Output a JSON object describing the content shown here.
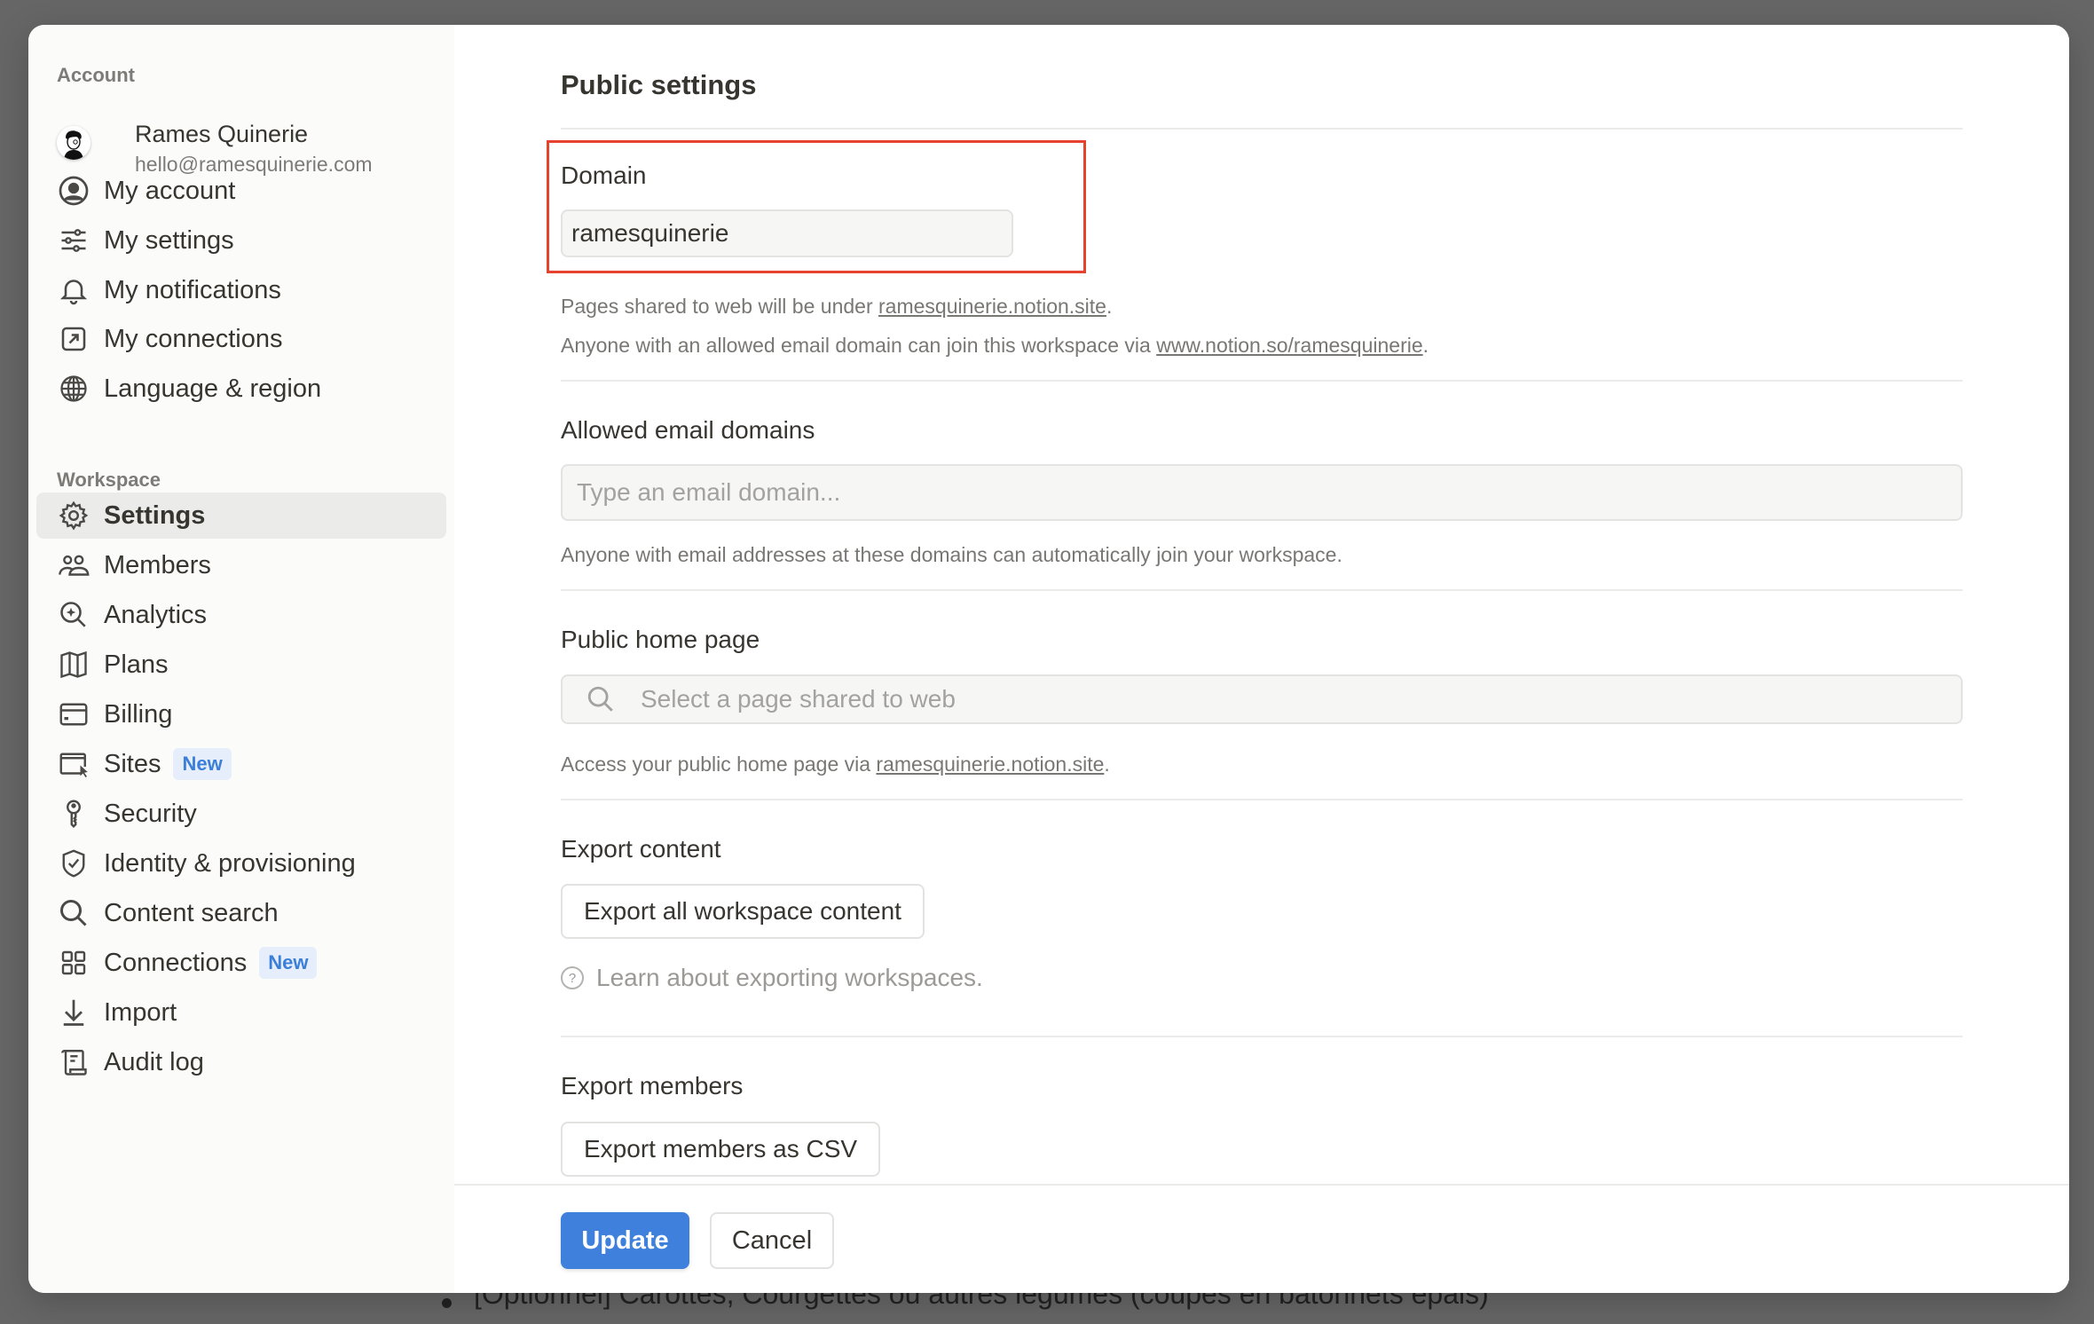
{
  "background": {
    "bullet_text": "[Optionnel] Carottes, Courgettes ou autres légumes (coupés en bâtonnets épais)"
  },
  "sidebar": {
    "account_label": "Account",
    "profile": {
      "name": "Rames Quinerie",
      "email": "hello@ramesquinerie.com"
    },
    "account_items": [
      {
        "label": "My account",
        "icon": "user-circle-icon"
      },
      {
        "label": "My settings",
        "icon": "sliders-icon"
      },
      {
        "label": "My notifications",
        "icon": "bell-icon"
      },
      {
        "label": "My connections",
        "icon": "external-link-box-icon"
      },
      {
        "label": "Language & region",
        "icon": "globe-icon"
      }
    ],
    "workspace_label": "Workspace",
    "workspace_items": [
      {
        "label": "Settings",
        "icon": "gear-icon",
        "active": true
      },
      {
        "label": "Members",
        "icon": "people-icon"
      },
      {
        "label": "Analytics",
        "icon": "magnifier-sparkle-icon"
      },
      {
        "label": "Plans",
        "icon": "map-icon"
      },
      {
        "label": "Billing",
        "icon": "credit-card-icon"
      },
      {
        "label": "Sites",
        "icon": "browser-cursor-icon",
        "badge": "New"
      },
      {
        "label": "Security",
        "icon": "key-icon"
      },
      {
        "label": "Identity & provisioning",
        "icon": "shield-check-icon"
      },
      {
        "label": "Content search",
        "icon": "search-icon"
      },
      {
        "label": "Connections",
        "icon": "grid-icon",
        "badge": "New"
      },
      {
        "label": "Import",
        "icon": "download-arrow-icon"
      },
      {
        "label": "Audit log",
        "icon": "scroll-icon"
      }
    ]
  },
  "main": {
    "title": "Public settings",
    "domain": {
      "label": "Domain",
      "value": "ramesquinerie",
      "help1_prefix": "Pages shared to web will be under ",
      "help1_link": "ramesquinerie.notion.site",
      "help1_suffix": ".",
      "help2_prefix": "Anyone with an allowed email domain can join this workspace via ",
      "help2_link": "www.notion.so/ramesquinerie",
      "help2_suffix": "."
    },
    "allowed_domains": {
      "label": "Allowed email domains",
      "placeholder": "Type an email domain...",
      "help": "Anyone with email addresses at these domains can automatically join your workspace."
    },
    "public_home": {
      "label": "Public home page",
      "placeholder": "Select a page shared to web",
      "help_prefix": "Access your public home page via ",
      "help_link": "ramesquinerie.notion.site",
      "help_suffix": "."
    },
    "export_content": {
      "label": "Export content",
      "button": "Export all workspace content",
      "learn": "Learn about exporting workspaces."
    },
    "export_members": {
      "label": "Export members",
      "button": "Export members as CSV"
    }
  },
  "footer": {
    "update": "Update",
    "cancel": "Cancel"
  },
  "colors": {
    "accent": "#3f80dc",
    "highlight_box": "#e5432e",
    "badge_bg": "#e5eefa",
    "badge_text": "#3c7fd8"
  }
}
